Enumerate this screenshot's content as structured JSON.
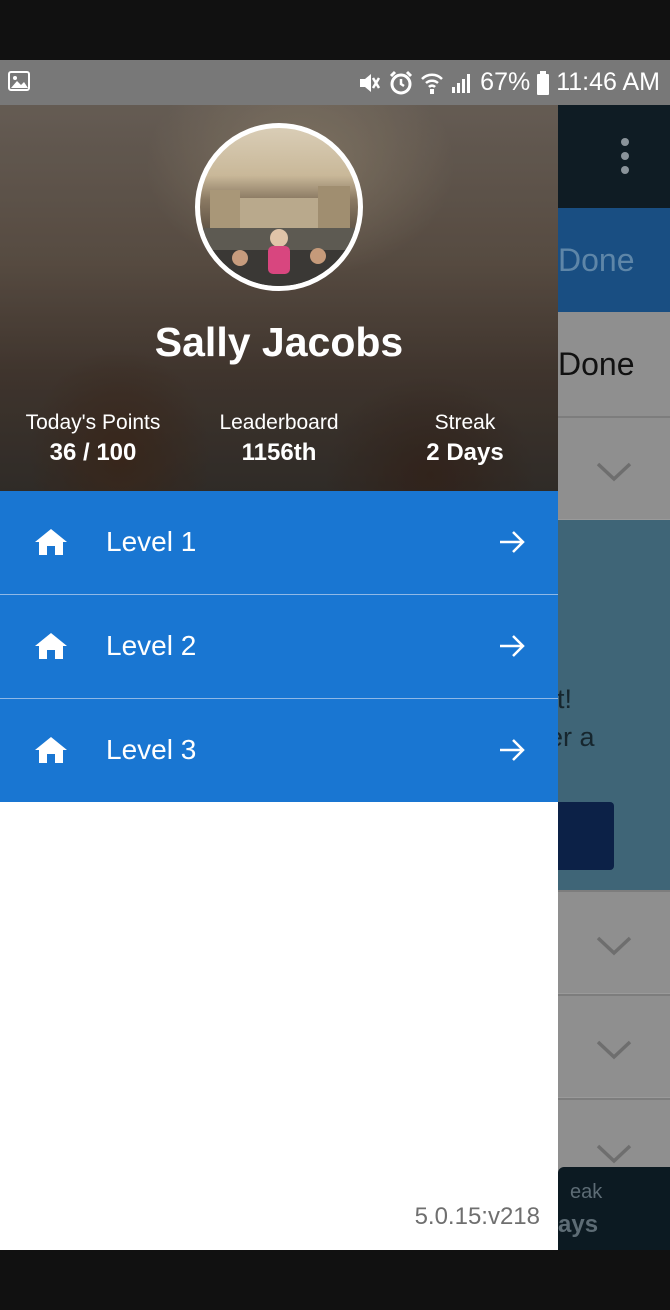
{
  "status_bar": {
    "battery": "67%",
    "time": "11:46 AM",
    "icons": [
      "image-icon",
      "mute-icon",
      "alarm-icon",
      "wifi-icon",
      "signal-icon",
      "battery-icon"
    ]
  },
  "background_app": {
    "tab1": "Done",
    "tab2": "Done",
    "card_text_line1": "rt!",
    "card_text_line2": "er a",
    "bottom_label": "eak",
    "bottom_value": "ays"
  },
  "drawer": {
    "user_name": "Sally Jacobs",
    "stats": {
      "points_label": "Today's Points",
      "points_value": "36 / 100",
      "leaderboard_label": "Leaderboard",
      "leaderboard_value": "1156th",
      "streak_label": "Streak",
      "streak_value": "2 Days"
    },
    "menu": [
      {
        "label": "Level 1",
        "icon": "home-icon"
      },
      {
        "label": "Level 2",
        "icon": "home-icon"
      },
      {
        "label": "Level 3",
        "icon": "home-icon"
      }
    ],
    "version": "5.0.15:v218"
  },
  "colors": {
    "menu_bg": "#1976d2",
    "status_bar": "#787878",
    "accent_dark": "#0f1c24"
  }
}
